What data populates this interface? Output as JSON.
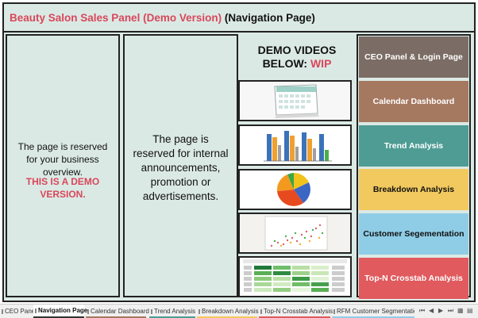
{
  "title": {
    "main": "Beauty Salon Sales Panel (Demo Version)",
    "suffix": " (Navigation Page)"
  },
  "business_panel": {
    "text": "The page is reserved for your business overview.",
    "demo_note": "THIS IS A DEMO VERSION."
  },
  "announcements_panel": {
    "text": "The page is reserved for internal announcements, promotion or advertisements."
  },
  "videos": {
    "header": "DEMO VIDEOS BELOW:",
    "wip": "WIP"
  },
  "nav_buttons": [
    {
      "label": "CEO Panel & Login Page",
      "color": "#7b6d65"
    },
    {
      "label": "Calendar Dashboard",
      "color": "#a57860"
    },
    {
      "label": "Trend Analysis",
      "color": "#4e9c94"
    },
    {
      "label": "Breakdown Analysis",
      "color": "#f2c95e",
      "text_color": "#111111"
    },
    {
      "label": "Customer Segementation",
      "color": "#8fcde6",
      "text_color": "#111111"
    },
    {
      "label": "Top-N Crosstab Analysis",
      "color": "#e05a5e"
    }
  ],
  "tabs": [
    {
      "label": "CEO Panel",
      "active": false
    },
    {
      "label": "Navigation Page",
      "active": true
    },
    {
      "label": "Calendar Dashboard",
      "active": false
    },
    {
      "label": "Trend Analysis",
      "active": false
    },
    {
      "label": "Breakdown Analysis",
      "active": false
    },
    {
      "label": "Top-N Crosstab Analysis",
      "active": false
    },
    {
      "label": "RFM Customer Segmentatio...",
      "active": false
    }
  ],
  "colors": {
    "accent_pink": "#d9475a",
    "panel_bg": "#dbe9e5"
  }
}
